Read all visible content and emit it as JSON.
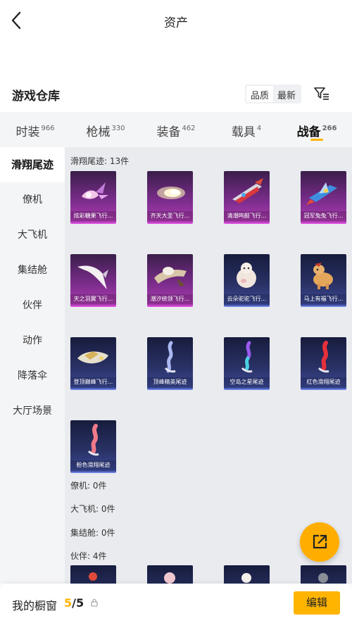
{
  "header": {
    "title": "资产",
    "back_icon": "chevron-left-icon"
  },
  "warehouse": {
    "title": "游戏仓库",
    "sort_options": [
      "品质",
      "最新"
    ],
    "sort_selected": "品质",
    "filter_icon": "filter-list-icon"
  },
  "category_tabs": [
    {
      "label": "时装",
      "count": "966",
      "active": false
    },
    {
      "label": "枪械",
      "count": "330",
      "active": false
    },
    {
      "label": "装备",
      "count": "462",
      "active": false
    },
    {
      "label": "载具",
      "count": "4",
      "active": false
    },
    {
      "label": "战备",
      "count": "266",
      "active": true
    }
  ],
  "sidebar": {
    "items": [
      {
        "label": "滑翔尾迹",
        "active": true
      },
      {
        "label": "僚机",
        "active": false
      },
      {
        "label": "大飞机",
        "active": false
      },
      {
        "label": "集结舱",
        "active": false
      },
      {
        "label": "伙伴",
        "active": false
      },
      {
        "label": "动作",
        "active": false
      },
      {
        "label": "降落伞",
        "active": false
      },
      {
        "label": "大厅场景",
        "active": false
      }
    ]
  },
  "content": {
    "sections": [
      {
        "label": "滑翔尾迹: 13件"
      },
      {
        "label": "僚机: 0件"
      },
      {
        "label": "大飞机: 0件"
      },
      {
        "label": "集结舱: 0件"
      },
      {
        "label": "伙伴: 4件"
      }
    ],
    "trail_items": [
      {
        "name": "炫彩糖果飞行...",
        "rarity": "purple",
        "icon": "candy-trail-icon"
      },
      {
        "name": "齐天大圣飞行...",
        "rarity": "purple",
        "icon": "cloud-trail-icon"
      },
      {
        "name": "清潮鸣舰飞行...",
        "rarity": "purple",
        "icon": "ship-trail-icon"
      },
      {
        "name": "冠军兔兔飞行...",
        "rarity": "purple",
        "icon": "rabbit-jet-icon"
      },
      {
        "name": "天之羽翼飞行...",
        "rarity": "purple",
        "icon": "wing-trail-icon"
      },
      {
        "name": "潮汐统领飞行...",
        "rarity": "purple",
        "icon": "tide-trail-icon"
      },
      {
        "name": "云朵驼驼飞行...",
        "rarity": "blue",
        "icon": "alpaca-cloud-icon"
      },
      {
        "name": "马上有福飞行...",
        "rarity": "blue",
        "icon": "horse-trail-icon"
      },
      {
        "name": "登顶巅峰飞行...",
        "rarity": "blue",
        "icon": "peak-jet-icon"
      },
      {
        "name": "顶峰精英尾迹",
        "rarity": "blue",
        "icon": "smoke-trail-icon"
      },
      {
        "name": "空岛之星尾迹",
        "rarity": "blue",
        "icon": "rainbow-smoke-icon"
      },
      {
        "name": "红色滑翔尾迹",
        "rarity": "blue",
        "icon": "red-smoke-icon"
      },
      {
        "name": "粉色滑翔尾迹",
        "rarity": "blue",
        "icon": "pink-smoke-icon"
      }
    ],
    "partner_items": [
      {
        "rarity": "blue"
      },
      {
        "rarity": "blue"
      },
      {
        "rarity": "blue"
      },
      {
        "rarity": "blue"
      }
    ]
  },
  "fab": {
    "icon": "share-external-icon"
  },
  "bottom_bar": {
    "label": "我的橱窗",
    "current": "5",
    "separator": "/",
    "max": "5",
    "lock_icon": "lock-icon",
    "edit_label": "编辑"
  },
  "colors": {
    "accent": "#ffb400",
    "purple_card": "#7e2d8e",
    "blue_card": "#2a3266"
  }
}
